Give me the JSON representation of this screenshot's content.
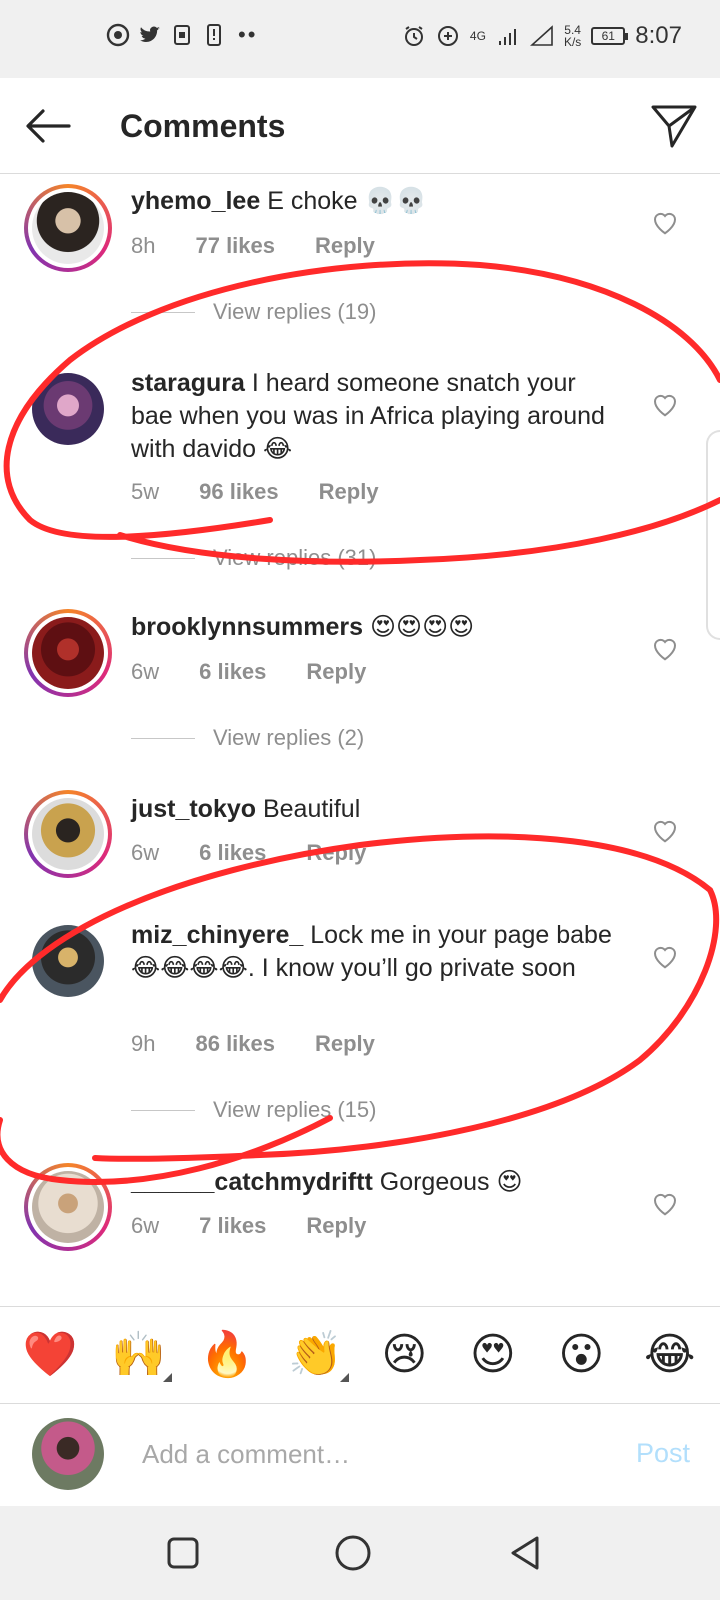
{
  "status_bar": {
    "net_speed_value": "5.4",
    "net_speed_unit": "K/s",
    "network_label": "4G",
    "battery_level": "61",
    "time": "8:07",
    "dots": "••"
  },
  "header": {
    "title": "Comments"
  },
  "comments": [
    {
      "username": "yhemo_lee",
      "text": " E choke 💀💀",
      "age": "8h",
      "likes": "77 likes",
      "reply_label": "Reply",
      "view_replies": "View replies (19)"
    },
    {
      "username": "staragura",
      "text": " I heard someone snatch your bae when you was in Africa playing around with davido 😂",
      "age": "5w",
      "likes": "96 likes",
      "reply_label": "Reply",
      "view_replies": "View replies (31)"
    },
    {
      "username": "brooklynnsummers",
      "text": " 😍😍😍😍",
      "age": "6w",
      "likes": "6 likes",
      "reply_label": "Reply",
      "view_replies": "View replies (2)"
    },
    {
      "username": "just_tokyo",
      "text": " Beautiful",
      "age": "6w",
      "likes": "6 likes",
      "reply_label": "Reply"
    },
    {
      "username": "miz_chinyere_",
      "text": " Lock me in your page babe😂😂😂😂. I know you’ll go private soon",
      "age": "9h",
      "likes": "86 likes",
      "reply_label": "Reply",
      "view_replies": "View replies (15)"
    },
    {
      "username": "______catchmydriftt",
      "text": " Gorgeous 😍",
      "age": "6w",
      "likes": "7 likes",
      "reply_label": "Reply"
    }
  ],
  "reactions": [
    "❤️",
    "🙌",
    "🔥",
    "👏",
    "😢",
    "😍",
    "😮",
    "😂"
  ],
  "composer": {
    "placeholder": "Add a comment…",
    "post_label": "Post"
  },
  "colors": {
    "annotation": "#ff2a2a",
    "post_disabled": "#b2dffc",
    "meta_gray": "#8e8e8e"
  }
}
